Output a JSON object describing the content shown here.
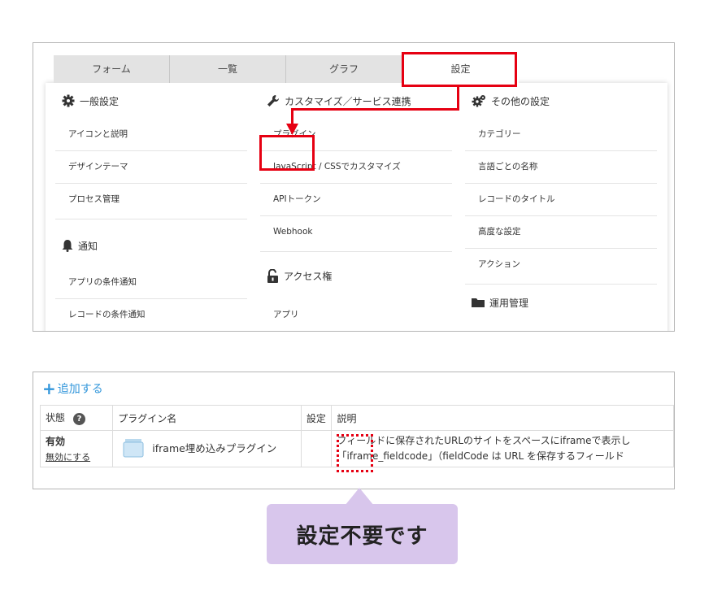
{
  "tabs": [
    "フォーム",
    "一覧",
    "グラフ",
    "設定"
  ],
  "columns": {
    "general": {
      "header": "一般設定",
      "items": [
        "アイコンと説明",
        "デザインテーマ",
        "プロセス管理"
      ],
      "sub_header": "通知",
      "sub_items": [
        "アプリの条件通知",
        "レコードの条件通知"
      ]
    },
    "customize": {
      "header": "カスタマイズ／サービス連携",
      "items": [
        "プラグイン",
        "JavaScript / CSSでカスタマイズ",
        "APIトークン",
        "Webhook"
      ],
      "sub_header": "アクセス権",
      "sub_items": [
        "アプリ"
      ]
    },
    "other": {
      "header": "その他の設定",
      "items": [
        "カテゴリー",
        "言語ごとの名称",
        "レコードのタイトル",
        "高度な設定",
        "アクション"
      ],
      "sub_header": "運用管理"
    }
  },
  "plugin_list": {
    "add_label": "追加する",
    "headers": {
      "status": "状態",
      "name": "プラグイン名",
      "settings": "設定",
      "description": "説明"
    },
    "row": {
      "status": "有効",
      "disable_link": "無効にする",
      "name": "iframe埋め込みプラグイン",
      "description_line1": "フィールドに保存されたURLのサイトをスペースにiframeで表示し",
      "description_line2": "「iframe_fieldcode」（fieldCode は URL を保存するフィールド"
    }
  },
  "callout": "設定不要です",
  "colors": {
    "highlight": "#e60012",
    "link": "#3397db",
    "callout_bg": "#d8c6ec"
  }
}
